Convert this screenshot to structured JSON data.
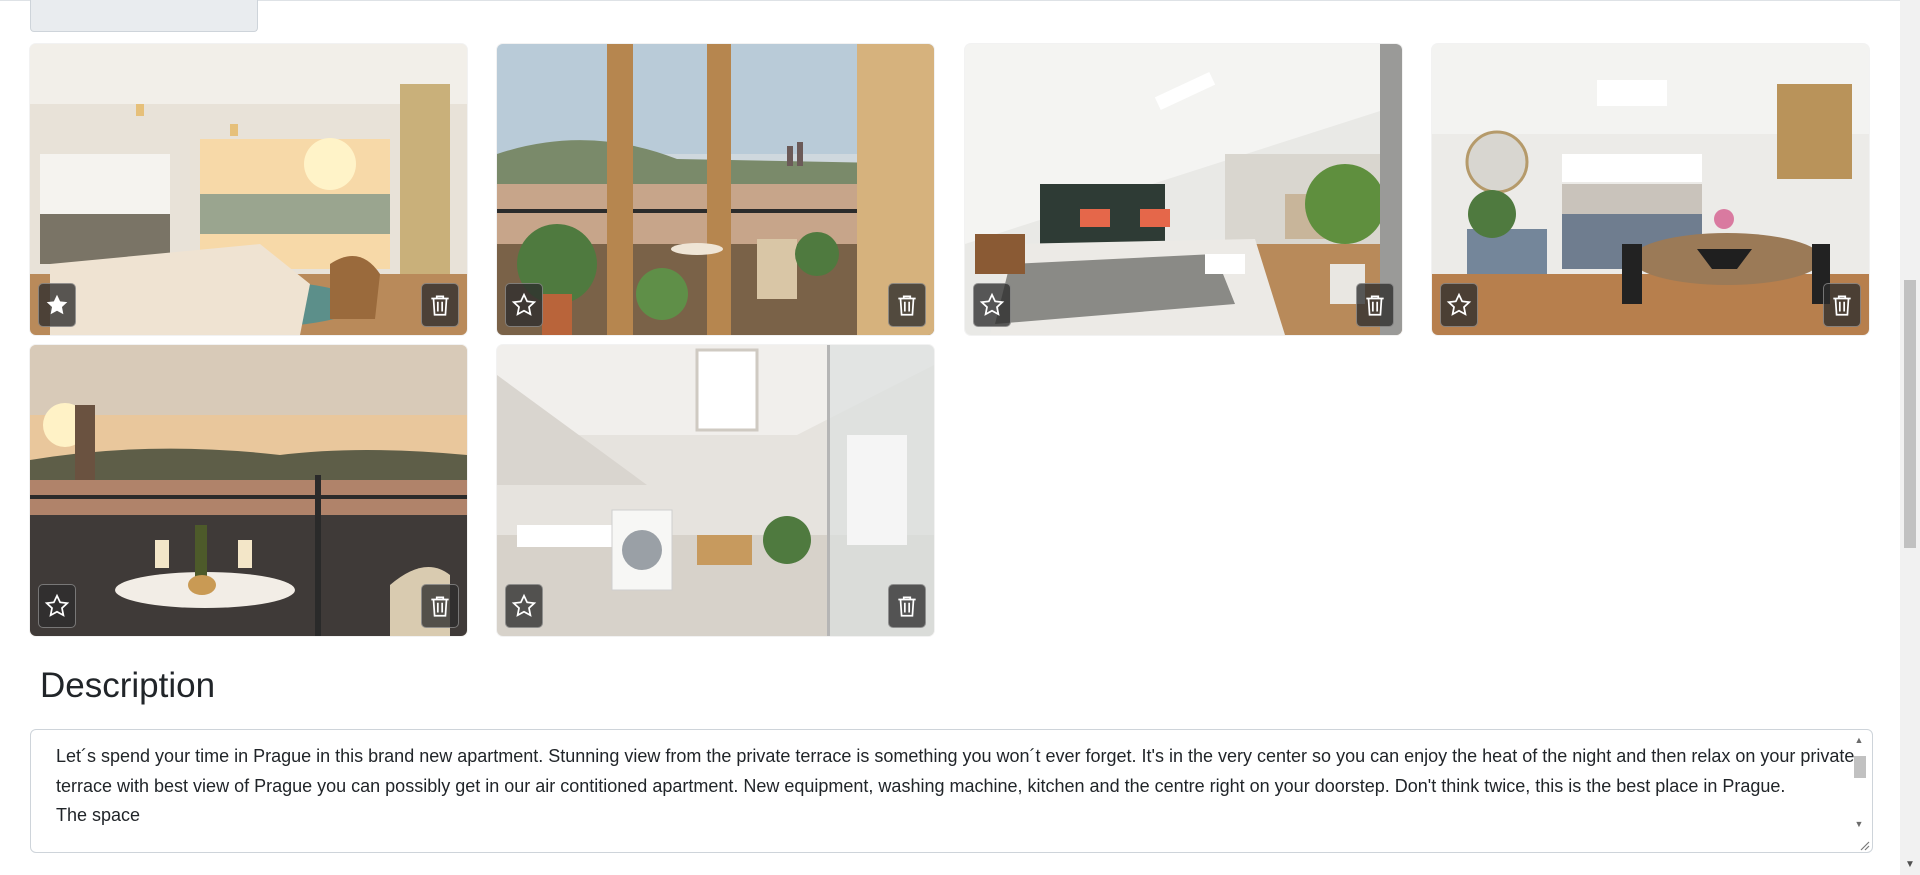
{
  "gallery": {
    "photos": [
      {
        "scene": "living-room-terrace",
        "featured": true
      },
      {
        "scene": "balcony-castle-view",
        "featured": false
      },
      {
        "scene": "bedroom",
        "featured": false
      },
      {
        "scene": "kitchen-dining",
        "featured": false
      },
      {
        "scene": "terrace-sunset",
        "featured": false
      },
      {
        "scene": "bathroom-laundry",
        "featured": false
      }
    ],
    "icons": {
      "featured": "star-filled-icon",
      "not_featured": "star-outline-icon",
      "delete": "trash-icon"
    }
  },
  "description": {
    "title": "Description",
    "text": "Let´s spend your time in Prague in this brand new apartment. Stunning view from the private terrace is something you won´t ever forget. It's in the very center so you can enjoy the heat of the night and then relax on your private terrace with best view of Prague you can possibly get in our air contitioned apartment. New equipment, washing machine, kitchen and the centre right on your doorstep. Don't think twice, this is the best place in Prague.\nThe space"
  },
  "colors": {
    "text": "#212529",
    "border": "#ced4da",
    "button_bg": "#2d2d2d"
  }
}
